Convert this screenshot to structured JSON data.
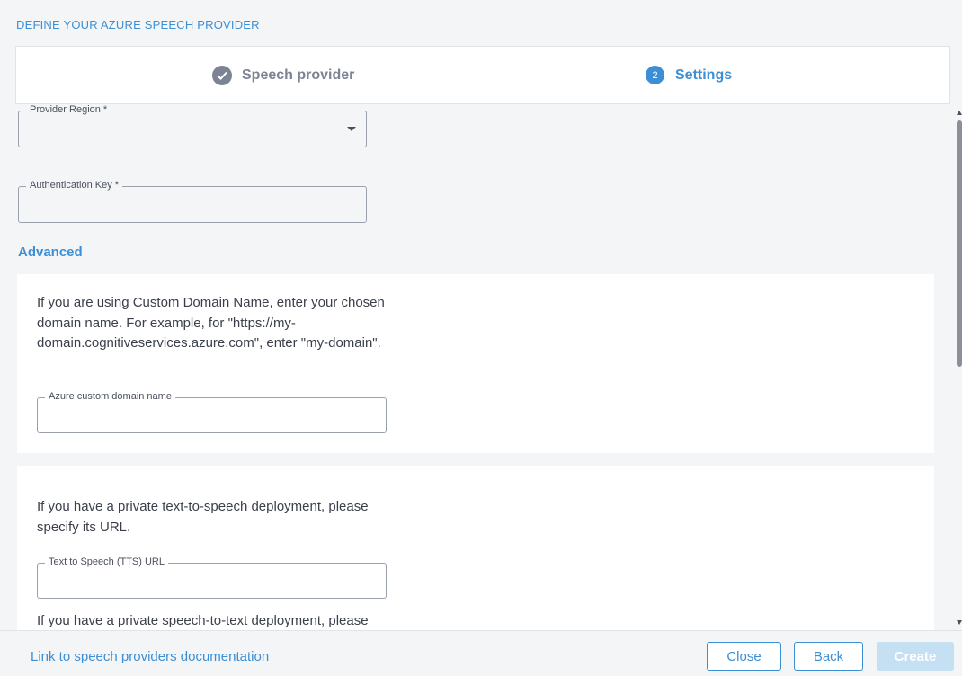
{
  "header": {
    "title": "DEFINE YOUR AZURE SPEECH PROVIDER"
  },
  "stepper": {
    "steps": [
      {
        "label": "Speech provider",
        "status": "completed",
        "icon": "check-circle-icon"
      },
      {
        "label": "Settings",
        "status": "active",
        "number": "2"
      }
    ]
  },
  "form": {
    "provider_region": {
      "label": "Provider Region *",
      "value": ""
    },
    "authentication_key": {
      "label": "Authentication Key *",
      "value": ""
    },
    "advanced_label": "Advanced",
    "custom_domain": {
      "description": "If you are using Custom Domain Name, enter your chosen domain name. For example, for \"https://my-domain.cognitiveservices.azure.com\", enter \"my-domain\".",
      "label": "Azure custom domain name",
      "value": ""
    },
    "tts": {
      "description": "If you have a private text-to-speech deployment, please specify its URL.",
      "label": "Text to Speech (TTS) URL",
      "value": ""
    },
    "stt": {
      "description": "If you have a private speech-to-text deployment, please"
    }
  },
  "footer": {
    "doc_link": "Link to speech providers documentation",
    "close_label": "Close",
    "back_label": "Back",
    "create_label": "Create"
  },
  "colors": {
    "accent": "#3c8fd4",
    "completed_step": "#7b8394",
    "disabled_button": "#c5dff3",
    "background": "#f4f5f7"
  }
}
